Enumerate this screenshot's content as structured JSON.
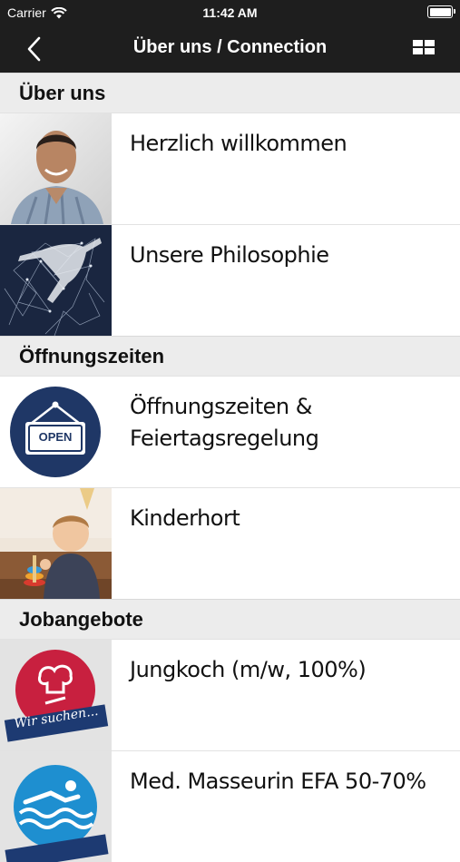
{
  "status_bar": {
    "carrier": "Carrier",
    "time": "11:42 AM"
  },
  "nav": {
    "title": "Über uns / Connection",
    "back_icon": "chevron-left-icon",
    "menu_icon": "grid-icon"
  },
  "sections": [
    {
      "title": "Über uns",
      "items": [
        {
          "lines": [
            "Herzlich willkommen"
          ],
          "image": "portrait-man"
        },
        {
          "lines": [
            "Unsere Philosophie"
          ],
          "image": "dancer-network"
        }
      ]
    },
    {
      "title": "Öffnungszeiten",
      "items": [
        {
          "lines": [
            "Öffnungszeiten &",
            "Feiertagsregelung"
          ],
          "image": "open-sign",
          "badge": "OPEN"
        },
        {
          "lines": [
            "Kinderhort"
          ],
          "image": "child-playing"
        }
      ]
    },
    {
      "title": "Jobangebote",
      "items": [
        {
          "lines": [
            "Jungkoch (m/w, 100%)"
          ],
          "image": "wir-suchen-chef",
          "badge": "Wir suchen..."
        },
        {
          "lines": [
            "Med. Masseurin EFA 50-70%"
          ],
          "image": "swimmer-badge"
        }
      ]
    }
  ],
  "colors": {
    "topbar": "#1e1e1e",
    "section_bg": "#ececec",
    "open_circle": "#1f3766",
    "jobs_red": "#c8203f",
    "banner_blue": "#1d3a72",
    "swim_blue": "#1e8fd0"
  }
}
